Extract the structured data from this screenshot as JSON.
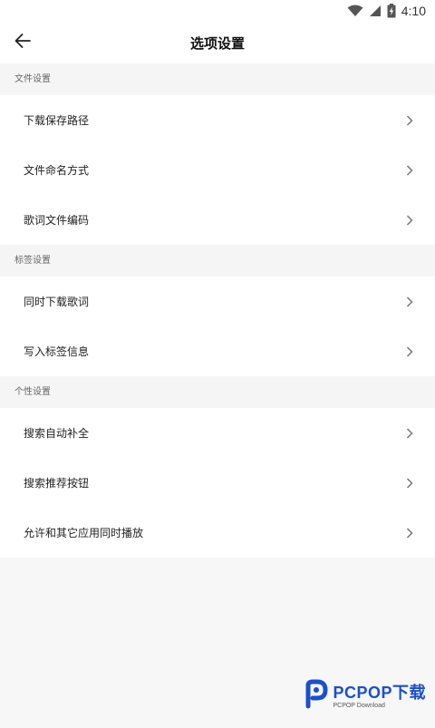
{
  "status_bar": {
    "time": "4:10",
    "icons": [
      "wifi-icon",
      "signal-icon",
      "battery-icon"
    ]
  },
  "app_bar": {
    "title": "选项设置",
    "back_icon": "arrow-left-icon"
  },
  "sections": [
    {
      "header": "文件设置",
      "items": [
        {
          "label": "下载保存路径"
        },
        {
          "label": "文件命名方式"
        },
        {
          "label": "歌词文件编码"
        }
      ]
    },
    {
      "header": "标签设置",
      "items": [
        {
          "label": "同时下载歌词"
        },
        {
          "label": "写入标签信息"
        }
      ]
    },
    {
      "header": "个性设置",
      "items": [
        {
          "label": "搜索自动补全"
        },
        {
          "label": "搜索推荐按钮"
        },
        {
          "label": "允许和其它应用同时播放"
        }
      ]
    }
  ],
  "watermark": {
    "brand": "PCPOP下载",
    "sub": "PCPOP Download"
  },
  "colors": {
    "background": "#f7f7f7",
    "list_background": "#ffffff",
    "watermark_blue": "#1a4fd0"
  }
}
